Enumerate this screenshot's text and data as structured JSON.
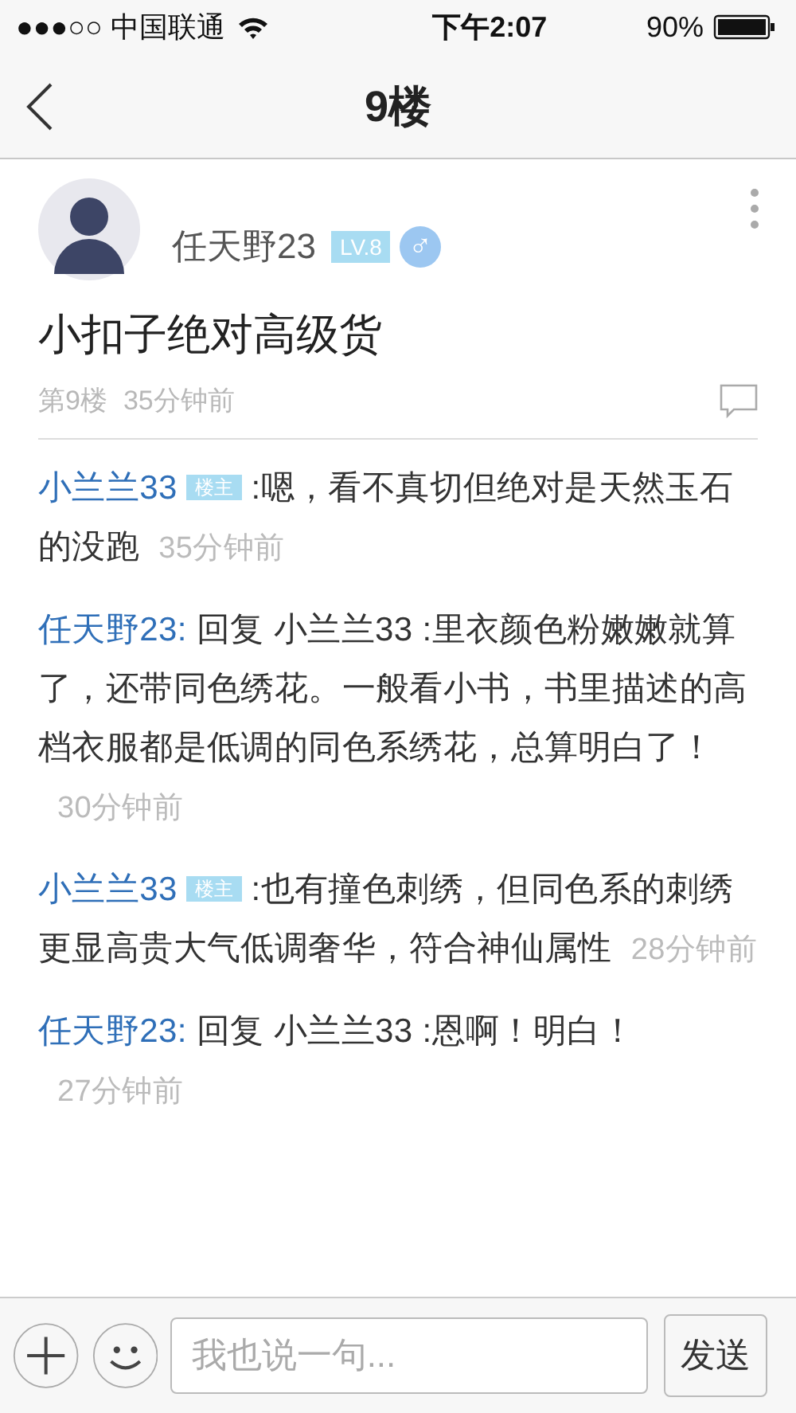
{
  "status_bar": {
    "carrier": "●●●○○ 中国联通",
    "time": "下午2:07",
    "battery": "90%"
  },
  "nav": {
    "title": "9楼"
  },
  "post": {
    "author": "任天野23",
    "level": "LV.8",
    "gender": "♂",
    "title": "小扣子绝对高级货",
    "floor": "第9楼",
    "time": "35分钟前"
  },
  "replies": [
    {
      "author": "小兰兰33",
      "badge": "楼主",
      "text": ":嗯，看不真切但绝对是天然玉石的没跑",
      "time": "35分钟前"
    },
    {
      "author": "任天野23:",
      "text": " 回复 小兰兰33 :里衣颜色粉嫩嫩就算了，还带同色绣花。一般看小书，书里描述的高档衣服都是低调的同色系绣花，总算明白了！",
      "time": "30分钟前"
    },
    {
      "author": "小兰兰33",
      "badge": "楼主",
      "text": ":也有撞色刺绣，但同色系的刺绣更显高贵大气低调奢华，符合神仙属性",
      "time": "28分钟前"
    },
    {
      "author": "任天野23:",
      "text": " 回复 小兰兰33 :恩啊！明白！",
      "time": "27分钟前"
    }
  ],
  "composer": {
    "placeholder": "我也说一句...",
    "send": "发送"
  }
}
